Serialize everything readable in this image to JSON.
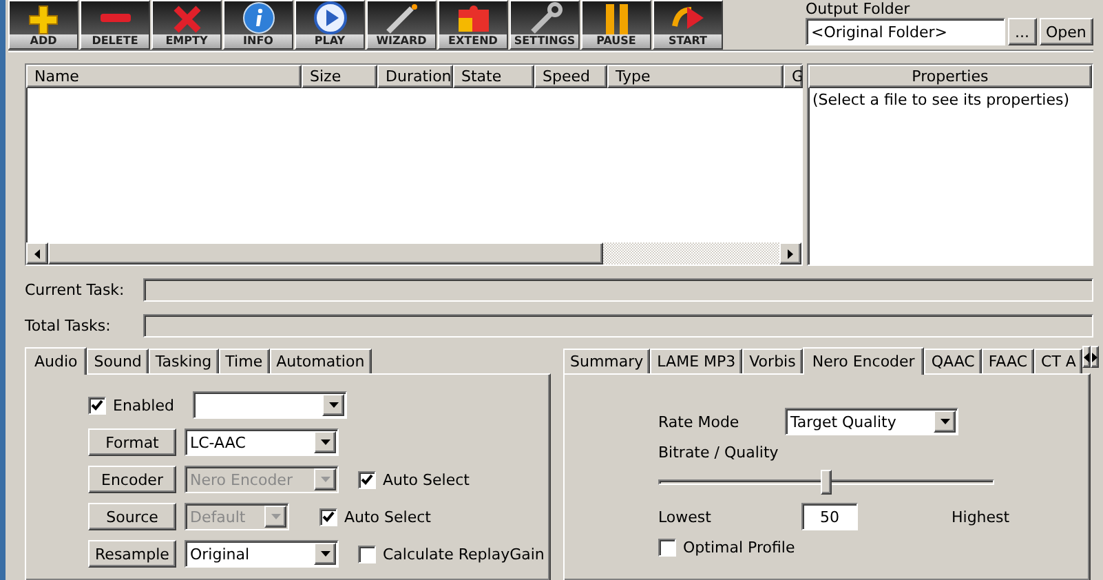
{
  "toolbar": [
    {
      "label": "ADD",
      "kind": "add"
    },
    {
      "label": "DELETE",
      "kind": "delete"
    },
    {
      "label": "EMPTY",
      "kind": "empty"
    },
    {
      "label": "INFO",
      "kind": "info"
    },
    {
      "label": "PLAY",
      "kind": "play"
    },
    {
      "label": "WIZARD",
      "kind": "wizard"
    },
    {
      "label": "EXTEND",
      "kind": "extend"
    },
    {
      "label": "SETTINGS",
      "kind": "settings"
    },
    {
      "label": "PAUSE",
      "kind": "pause"
    },
    {
      "label": "START",
      "kind": "start"
    }
  ],
  "output_folder": {
    "label": "Output Folder",
    "value": "<Original Folder>",
    "browse": "...",
    "open": "Open"
  },
  "table": {
    "columns": [
      "Name",
      "Size",
      "Duration",
      "State",
      "Speed",
      "Type",
      "G"
    ]
  },
  "properties": {
    "title": "Properties",
    "hint": "(Select a file to see its properties)"
  },
  "progress": [
    {
      "label": "Current Task:",
      "level": 0
    },
    {
      "label": "Total Tasks:",
      "level": 0
    }
  ],
  "left_tabs": [
    {
      "label": "Audio",
      "selected": true
    },
    {
      "label": "Sound",
      "selected": false
    },
    {
      "label": "Tasking",
      "selected": false
    },
    {
      "label": "Time",
      "selected": false
    },
    {
      "label": "Automation",
      "selected": false
    }
  ],
  "audio": {
    "enabled": {
      "label": "Enabled",
      "checked": true
    },
    "rows": [
      {
        "button": "Format",
        "value": "LC-AAC",
        "disabled": false,
        "option": null
      },
      {
        "button": "Encoder",
        "value": "Nero Encoder",
        "disabled": true,
        "option": {
          "label": "Auto Select",
          "checked": true
        }
      },
      {
        "button": "Source",
        "value": "Default",
        "disabled": true,
        "option": {
          "label": "Auto Select",
          "checked": true
        }
      },
      {
        "button": "Resample",
        "value": "Original",
        "disabled": false,
        "option": {
          "label": "Calculate ReplayGain",
          "checked": false
        }
      }
    ]
  },
  "right_tabs": [
    {
      "label": "Summary",
      "selected": false
    },
    {
      "label": "LAME MP3",
      "selected": false
    },
    {
      "label": "Vorbis",
      "selected": false
    },
    {
      "label": "Nero Encoder",
      "selected": true
    },
    {
      "label": "QAAC",
      "selected": false
    },
    {
      "label": "FAAC",
      "selected": false
    },
    {
      "label": "CT A",
      "selected": false
    }
  ],
  "nero": {
    "rate_mode_label": "Rate Mode",
    "rate_mode": "Target Quality",
    "bitrate_label": "Bitrate / Quality",
    "slider": {
      "level": 0.5
    },
    "lowest": "Lowest",
    "value": "50",
    "highest": "Highest",
    "optimal": {
      "label": "Optimal Profile",
      "checked": false
    }
  }
}
